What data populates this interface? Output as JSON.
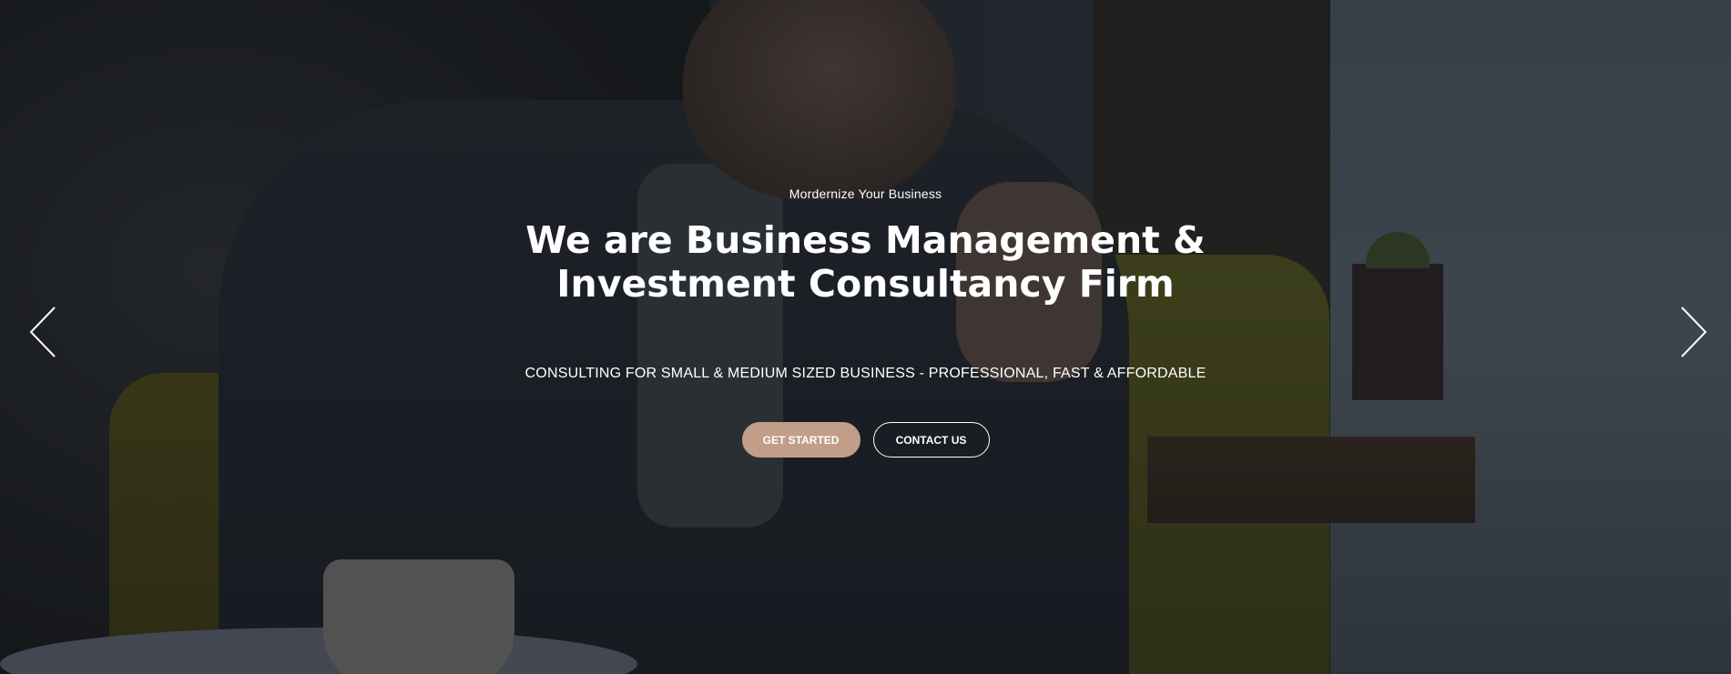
{
  "hero": {
    "tagline": "Mordernize Your Business",
    "headline": "We are Business Management & Investment Consultancy Firm",
    "subline": "CONSULTING FOR SMALL & MEDIUM SIZED BUSINESS - PROFESSIONAL, FAST & AFFORDABLE",
    "primary_button": "GET STARTED",
    "secondary_button": "CONTACT US"
  },
  "slider": {
    "prev_icon": "chevron-left-icon",
    "next_icon": "chevron-right-icon"
  },
  "colors": {
    "accent": "#c29d88",
    "text": "#ffffff"
  }
}
